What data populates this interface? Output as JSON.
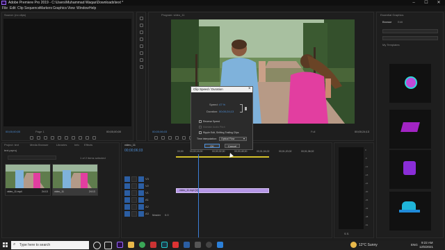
{
  "titlebar": {
    "title": "Adobe Premiere Pro 2019 - C:\\Users\\Muhammad Waqas\\Downloads\\text *",
    "minimize": "–",
    "maximize": "☐",
    "close": "✕"
  },
  "menu": [
    "File",
    "Edit",
    "Clip",
    "Sequence",
    "Markers",
    "Graphics",
    "View",
    "Window",
    "Help"
  ],
  "source_monitor": {
    "tab": "Source: (no clips)",
    "timecode_left": "00;00;00;00",
    "timecode_right": "00;00;00;00",
    "page": "Page 1"
  },
  "program_monitor": {
    "tab": "Program: video_11",
    "timecode_left": "00;00;06;03",
    "fit": "Fit",
    "quality": "Full",
    "timecode_right": "00;00;24;13"
  },
  "project": {
    "tab": "Project: text",
    "tabs": [
      "Media Browser",
      "Libraries",
      "Info",
      "Effects"
    ],
    "search_label": "text.prproj",
    "items_selected": "1 of 2 items selected",
    "clips": [
      {
        "name": "video_11.mp4",
        "duration": "24:13"
      },
      {
        "name": "video_11",
        "duration": "24:13"
      }
    ]
  },
  "timeline": {
    "tab": "video_11",
    "timecode": "00;00;06;03",
    "ruler": [
      "00;00",
      "00;00;16;00",
      "00;00;32;00",
      "00;00;48;00",
      "00;01;04;02",
      "00;01;20;02",
      "00;01;36;02"
    ],
    "clip_label": "video_11.mp4 [V]",
    "video_tracks": [
      "V3",
      "V2",
      "V1"
    ],
    "audio_tracks": [
      "A1",
      "A2",
      "A3"
    ],
    "master": "Master",
    "master_val": "0.0"
  },
  "dialog": {
    "title": "Clip Speed / Duration",
    "speed_label": "Speed:",
    "speed_value": "47 %",
    "duration_label": "Duration:",
    "duration_value": "00;00;24;13",
    "reverse": "Reverse Speed",
    "maintain_pitch": "Maintain Audio Pitch",
    "ripple": "Ripple Edit, Shifting Trailing Clips",
    "interp_label": "Time Interpolation:",
    "interp_value": "Optical Flow",
    "ok": "OK",
    "cancel": "Cancel"
  },
  "essential_graphics": {
    "tab": "Essential Graphics",
    "browse": "Browse",
    "edit": "Edit",
    "my_templates": "My Templates"
  },
  "audio_meter": {
    "ticks": [
      "0",
      "-6",
      "-12",
      "-18",
      "-24",
      "-30",
      "-36",
      "-42",
      "-48",
      "-54"
    ],
    "footer": "S  S"
  },
  "taskbar": {
    "search_placeholder": "Type here to search",
    "weather": "12°C  Sunny",
    "lang": "ENG",
    "time": "9:22 AM",
    "date": "12/5/2021"
  },
  "colors": {
    "accent_blue": "#2b5ea3",
    "clip_purple": "#b597e6",
    "timecode_blue": "#4e8fd8",
    "work_area_yellow": "#d6c22a"
  }
}
